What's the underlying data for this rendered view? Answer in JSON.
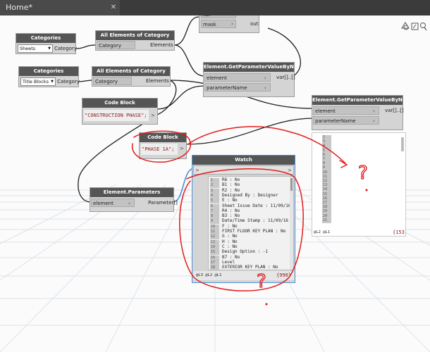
{
  "window": {
    "tab_title": "Home*",
    "tab_close": "✕"
  },
  "toolbar": {
    "icons": [
      "view-3d-icon",
      "view-graph-icon",
      "zoom-icon"
    ]
  },
  "colors": {
    "wire": "#1f1f1f",
    "selected_wire": "#4a90d9",
    "annotation": "#e21b1b",
    "node_header": "#555555"
  },
  "nodes": {
    "top": {
      "port1": "list",
      "port2": "mask",
      "out1": "in",
      "out2": "out"
    },
    "categories1": {
      "title": "Categories",
      "value": "Sheets",
      "out": "Category"
    },
    "categories2": {
      "title": "Categories",
      "value": "Title Blocks",
      "out": "Category"
    },
    "all_elements1": {
      "title": "All Elements of Category",
      "in": "Category",
      "out": "Elements"
    },
    "all_elements2": {
      "title": "All Elements of Category",
      "in": "Category",
      "out": "Elements"
    },
    "get_param1": {
      "title": "Element.GetParameterValueByName",
      "in1": "element",
      "in2": "parameterName",
      "out": "var[]..[]"
    },
    "get_param2": {
      "title": "Element.GetParameterValueByName",
      "in1": "element",
      "in2": "parameterName",
      "out": "var[]..[]"
    },
    "code_block1": {
      "title": "Code Block",
      "code": "\"CONSTRUCTION PHASE\";"
    },
    "code_block2": {
      "title": "Code Block",
      "code": "\"PHASE 1A\";"
    },
    "element_params": {
      "title": "Element.Parameters",
      "in": "element",
      "out": "Parameter[]"
    },
    "watch": {
      "title": "Watch",
      "rows": [
        {
          "idx": "1",
          "text": "R6 : No"
        },
        {
          "idx": "2",
          "text": "B1 : No"
        },
        {
          "idx": "3",
          "text": "R2 : No"
        },
        {
          "idx": "4",
          "text": "Designed By : Designer"
        },
        {
          "idx": "5",
          "text": "E : No"
        },
        {
          "idx": "6",
          "text": "Sheet Issue Date : 11/09/16"
        },
        {
          "idx": "7",
          "text": "R4 : No"
        },
        {
          "idx": "8",
          "text": "B3 : No"
        },
        {
          "idx": "9",
          "text": "Date/Time Stamp : 11/09/16"
        },
        {
          "idx": "10",
          "text": "F : No"
        },
        {
          "idx": "11",
          "text": "FIRST FLOOR KEY PLAN : No"
        },
        {
          "idx": "12",
          "text": "G : No"
        },
        {
          "idx": "13",
          "text": "H : No"
        },
        {
          "idx": "14",
          "text": "C : No"
        },
        {
          "idx": "15",
          "text": "Design Option : -1"
        },
        {
          "idx": "16",
          "text": "B7 : No"
        },
        {
          "idx": "17",
          "text": "Level"
        },
        {
          "idx": "18",
          "text": "EXTERIOR KEY PLAN : No"
        }
      ],
      "footer_levels": "@L3 @L2 @L1",
      "footer_count": "{990}"
    },
    "output_preview": {
      "footer_levels": "@L2 @L1",
      "footer_count": "{153}",
      "rows": [
        "2",
        "3",
        "4",
        "5",
        "6",
        "7",
        "8",
        "9",
        "10",
        "11",
        "12",
        "13",
        "14",
        "15",
        "16",
        "17",
        "18",
        "19",
        "20",
        "21"
      ]
    }
  },
  "annotations": {
    "question_mark": "?"
  }
}
